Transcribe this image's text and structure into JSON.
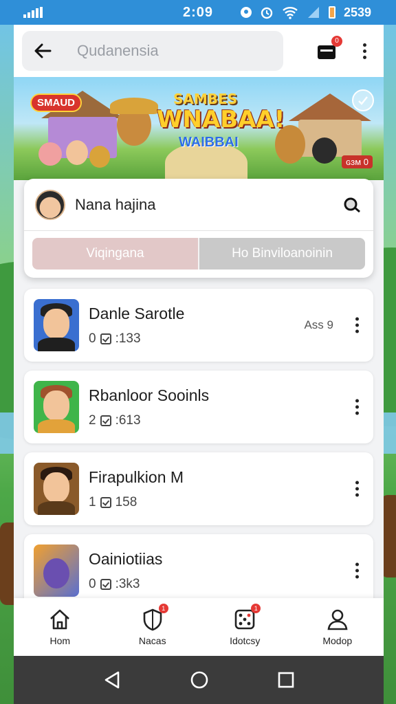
{
  "status_bar": {
    "time": "2:09",
    "battery": "2539"
  },
  "topbar": {
    "search_placeholder": "Qudanensia",
    "cart_badge": "0"
  },
  "banner": {
    "title_line1": "SAMBES",
    "title_line2": "WNABAA!",
    "title_line3": "WAIBBAI",
    "tag_left": "SMAUD",
    "tag_right": "ɢɜᴍ 0"
  },
  "profile": {
    "name": "Nana hajina",
    "segment_left": "Viqingana",
    "segment_right": "Ho Binviloanoinin"
  },
  "games": [
    {
      "title": "Danle Sarotle",
      "count": "0",
      "score": ":133",
      "side": "Ass 9",
      "theme": "chef"
    },
    {
      "title": "Rbanloor Sooinls",
      "count": "2",
      "score": ":613",
      "side": "",
      "theme": "boy"
    },
    {
      "title": "Firapulkion M",
      "count": "1",
      "score": "158",
      "side": "",
      "theme": "warrior"
    },
    {
      "title": "Oainiotiias",
      "count": "0",
      "score": ":3k3",
      "side": "",
      "theme": "monster"
    }
  ],
  "bottom_nav": [
    {
      "label": "Hom",
      "icon": "home-icon",
      "badge": ""
    },
    {
      "label": "Nacas",
      "icon": "shield-icon",
      "badge": "1"
    },
    {
      "label": "Idotcsy",
      "icon": "dice-icon",
      "badge": "1"
    },
    {
      "label": "Modop",
      "icon": "person-icon",
      "badge": ""
    }
  ],
  "colors": {
    "status_bar": "#2f8fd8",
    "badge": "#e53935",
    "segment_active": "#e2c8c8",
    "segment_inactive": "#c9c9c9",
    "system_nav": "#3b3b3b"
  }
}
